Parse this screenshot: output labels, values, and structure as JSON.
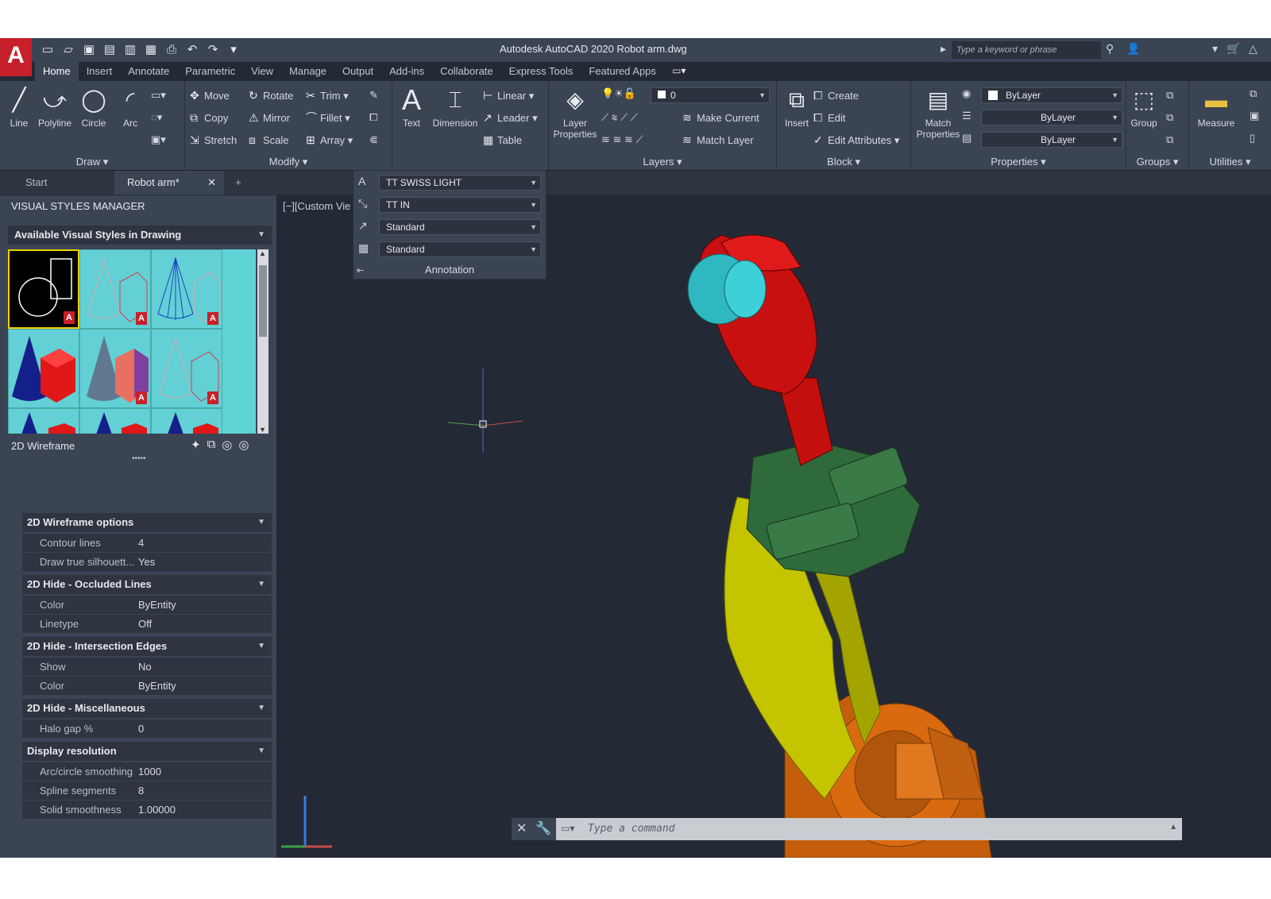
{
  "window": {
    "title": "Autodesk AutoCAD 2020    Robot arm.dwg",
    "search_placeholder": "Type a keyword or phrase"
  },
  "ribbon_tabs": [
    "Home",
    "Insert",
    "Annotate",
    "Parametric",
    "View",
    "Manage",
    "Output",
    "Add-ins",
    "Collaborate",
    "Express Tools",
    "Featured Apps"
  ],
  "draw": {
    "title": "Draw",
    "line": "Line",
    "polyline": "Polyline",
    "circle": "Circle",
    "arc": "Arc"
  },
  "modify": {
    "title": "Modify",
    "move": "Move",
    "rotate": "Rotate",
    "trim": "Trim",
    "copy": "Copy",
    "mirror": "Mirror",
    "fillet": "Fillet",
    "stretch": "Stretch",
    "scale": "Scale",
    "array": "Array"
  },
  "annotation": {
    "text": "Text",
    "dimension": "Dimension",
    "linear": "Linear",
    "leader": "Leader",
    "table": "Table",
    "title": "Annotation",
    "text_style": "TT SWISS LIGHT",
    "dim_style": "TT IN",
    "leader_style": "Standard",
    "table_style": "Standard"
  },
  "layers": {
    "title": "Layers",
    "layer_properties": "Layer Properties",
    "current_layer": "0",
    "make_current": "Make Current",
    "match_layer": "Match Layer"
  },
  "block": {
    "title": "Block",
    "insert": "Insert",
    "create": "Create",
    "edit": "Edit",
    "edit_attributes": "Edit Attributes"
  },
  "properties": {
    "title": "Properties",
    "match_properties": "Match Properties",
    "color": "ByLayer",
    "linetype": "ByLayer",
    "lineweight": "ByLayer"
  },
  "groups": {
    "title": "Groups",
    "group": "Group"
  },
  "utilities": {
    "title": "Utilities",
    "measure": "Measure"
  },
  "doc_tabs": {
    "start": "Start",
    "active": "Robot arm*"
  },
  "viewport": {
    "label": "[−][Custom Vie"
  },
  "palette": {
    "title": "VISUAL STYLES MANAGER",
    "available": "Available Visual Styles in Drawing",
    "current_style": "2D Wireframe",
    "sections": [
      {
        "title": "2D Wireframe options",
        "rows": [
          {
            "k": "Contour lines",
            "v": "4"
          },
          {
            "k": "Draw true silhouett...",
            "v": "Yes"
          }
        ]
      },
      {
        "title": "2D Hide - Occluded Lines",
        "rows": [
          {
            "k": "Color",
            "v": "ByEntity"
          },
          {
            "k": "Linetype",
            "v": "Off"
          }
        ]
      },
      {
        "title": "2D Hide - Intersection Edges",
        "rows": [
          {
            "k": "Show",
            "v": "No"
          },
          {
            "k": "Color",
            "v": "ByEntity"
          }
        ]
      },
      {
        "title": "2D Hide - Miscellaneous",
        "rows": [
          {
            "k": "Halo gap %",
            "v": "0"
          }
        ]
      },
      {
        "title": "Display resolution",
        "rows": [
          {
            "k": "Arc/circle smoothing",
            "v": "1000"
          },
          {
            "k": "Spline segments",
            "v": "8"
          },
          {
            "k": "Solid smoothness",
            "v": "1.00000"
          }
        ]
      }
    ]
  },
  "command": {
    "placeholder": "Type a command"
  },
  "colors": {
    "accent": "#c8202b",
    "ribbon": "#3b4453",
    "canvas": "#242a35",
    "arm_red": "#cc1010",
    "arm_green": "#2f6a3a",
    "arm_yellow": "#c8c800",
    "arm_orange": "#d06a10",
    "arm_cyan": "#2fc0c8"
  },
  "icons": [
    "autocad-logo",
    "new-icon",
    "open-icon",
    "save-icon",
    "print-icon",
    "undo-icon",
    "redo-icon",
    "binoculars-icon",
    "user-icon",
    "cart-icon"
  ]
}
